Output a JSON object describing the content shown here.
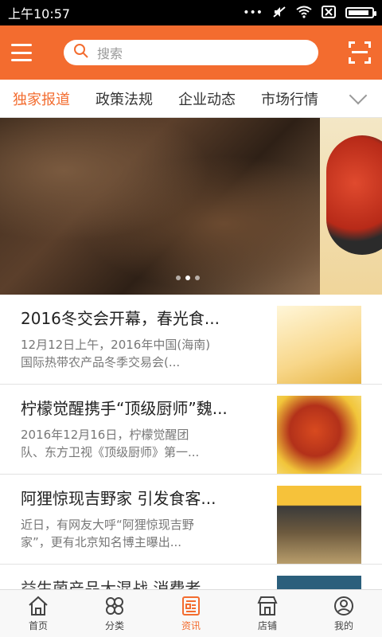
{
  "status_bar": {
    "time": "上午10:57",
    "icons": [
      "dots-icon",
      "mute-icon",
      "wifi-icon",
      "no-sim-icon",
      "battery-icon"
    ],
    "battery_level": 0.9
  },
  "header": {
    "search_placeholder": "搜索",
    "menu_icon": "hamburger-icon",
    "scan_icon": "scan-icon",
    "accent_color": "#f36c2f"
  },
  "tabs": [
    {
      "label": "独家报道",
      "active": true
    },
    {
      "label": "政策法规",
      "active": false
    },
    {
      "label": "企业动态",
      "active": false
    },
    {
      "label": "市场行情",
      "active": false
    }
  ],
  "banner": {
    "current_slide": 2,
    "total_slides": 3
  },
  "articles": [
    {
      "title": "2016冬交会开幕，春光食...",
      "desc_line1": "12月12日上午，2016年中国(海南)",
      "desc_line2": "国际热带农产品冬季交易会(..."
    },
    {
      "title": "柠檬觉醒携手“顶级厨师”魏...",
      "desc_line1": "2016年12月16日，柠檬觉醒团",
      "desc_line2": "队、东方卫视《顶级厨师》第一..."
    },
    {
      "title": "阿狸惊现吉野家 引发食客...",
      "desc_line1": "近日，有网友大呼“阿狸惊现吉野",
      "desc_line2": "家”，更有北京知名博主曝出..."
    },
    {
      "title": "益生菌产品大混战 消费者..."
    }
  ],
  "bottom_nav": [
    {
      "label": "首页",
      "icon": "home-icon",
      "active": false
    },
    {
      "label": "分类",
      "icon": "category-icon",
      "active": false
    },
    {
      "label": "资讯",
      "icon": "news-icon",
      "active": true
    },
    {
      "label": "店铺",
      "icon": "store-icon",
      "active": false
    },
    {
      "label": "我的",
      "icon": "profile-icon",
      "active": false
    }
  ]
}
